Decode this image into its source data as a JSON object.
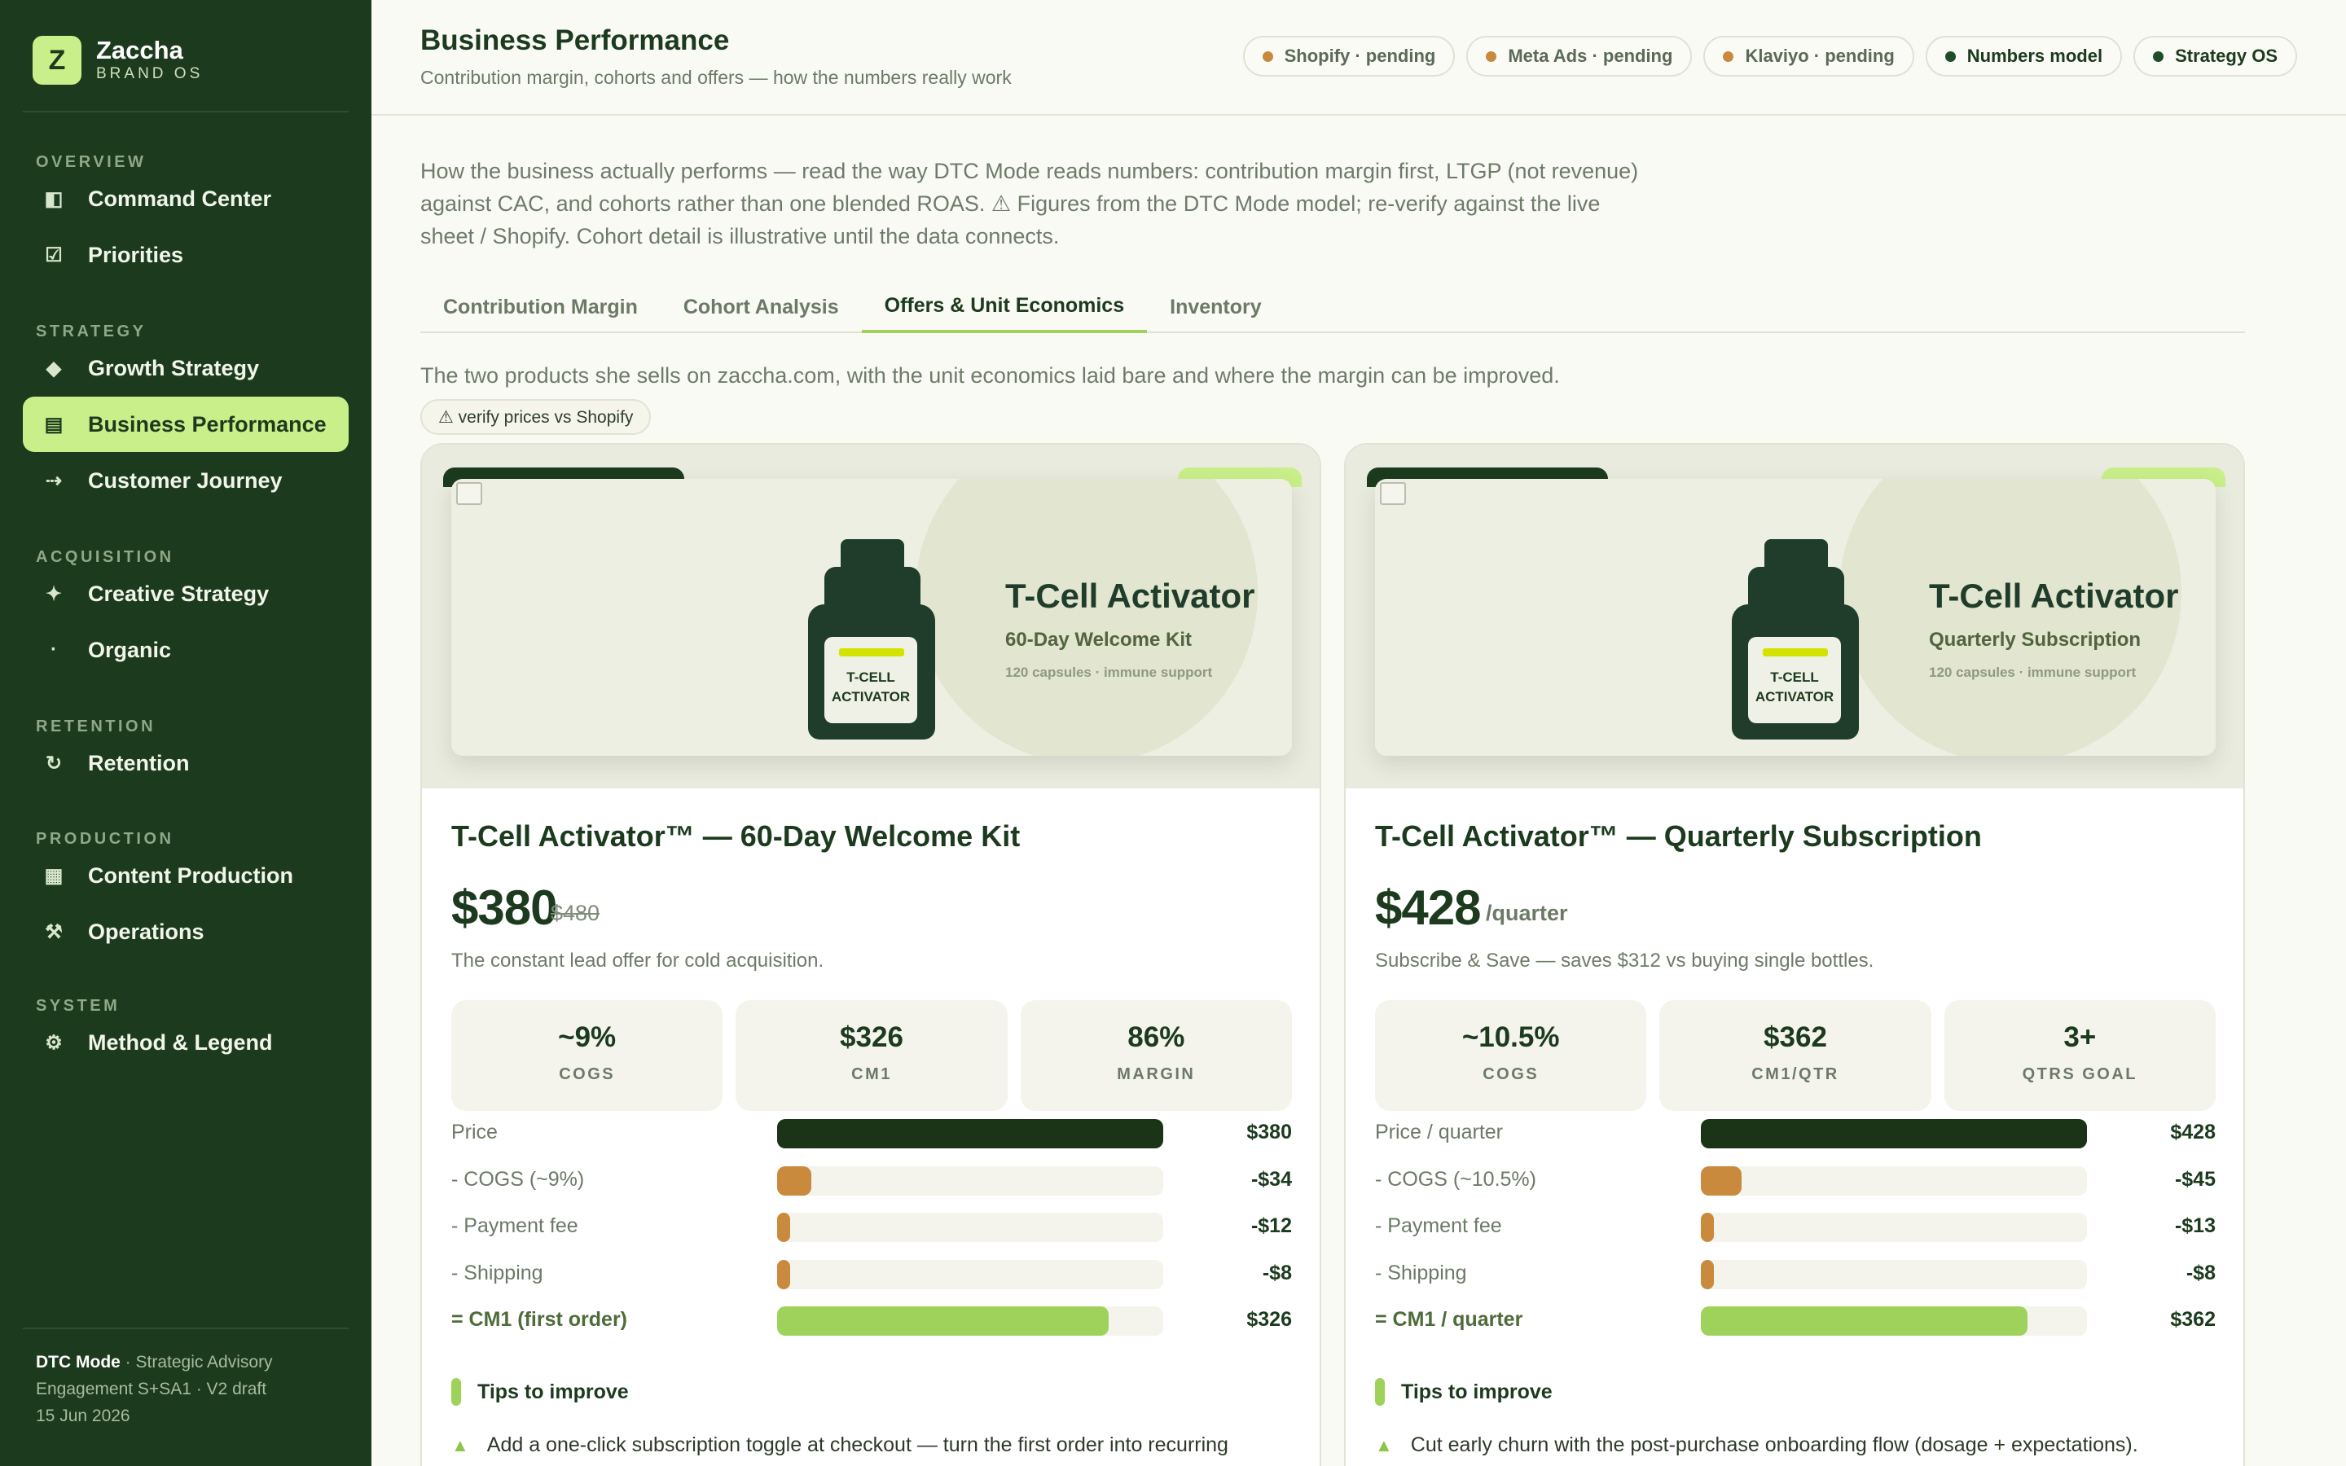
{
  "brand": {
    "logo_letter": "Z",
    "name": "Zaccha",
    "sub": "BRAND OS"
  },
  "sidebar": {
    "sections": [
      {
        "title": "OVERVIEW",
        "items": [
          {
            "label": "Command Center",
            "icon": "panel-icon",
            "glyph": "◧"
          },
          {
            "label": "Priorities",
            "icon": "checkbox-icon",
            "glyph": "☑"
          }
        ]
      },
      {
        "title": "STRATEGY",
        "items": [
          {
            "label": "Growth Strategy",
            "icon": "diamond-icon",
            "glyph": "◆"
          },
          {
            "label": "Business Performance",
            "icon": "report-icon",
            "glyph": "▤",
            "active": true
          },
          {
            "label": "Customer Journey",
            "icon": "journey-arrow-icon",
            "glyph": "⇢"
          }
        ]
      },
      {
        "title": "ACQUISITION",
        "items": [
          {
            "label": "Creative Strategy",
            "icon": "sparkle-icon",
            "glyph": "✦"
          },
          {
            "label": "Organic",
            "icon": "dot-icon",
            "glyph": "·"
          }
        ]
      },
      {
        "title": "RETENTION",
        "items": [
          {
            "label": "Retention",
            "icon": "refresh-icon",
            "glyph": "↻"
          }
        ]
      },
      {
        "title": "PRODUCTION",
        "items": [
          {
            "label": "Content Production",
            "icon": "grid-icon",
            "glyph": "▦"
          },
          {
            "label": "Operations",
            "icon": "tools-icon",
            "glyph": "⚒"
          }
        ]
      },
      {
        "title": "SYSTEM",
        "items": [
          {
            "label": "Method & Legend",
            "icon": "gear-icon",
            "glyph": "⚙"
          }
        ]
      }
    ],
    "footer": {
      "brand": "DTC Mode",
      "line1": " · Strategic Advisory",
      "line2": "Engagement S+SA1 · V2 draft",
      "line3": "15 Jun 2026"
    }
  },
  "header": {
    "title": "Business Performance",
    "subtitle": "Contribution margin, cohorts and offers — how the numbers really work",
    "pills": [
      {
        "label": "Shopify · pending",
        "color": "#c98a3e"
      },
      {
        "label": "Meta Ads · pending",
        "color": "#c98a3e"
      },
      {
        "label": "Klaviyo · pending",
        "color": "#c98a3e"
      },
      {
        "label": "Numbers model",
        "color": "#1f4d2a"
      },
      {
        "label": "Strategy OS",
        "color": "#1f4d2a"
      }
    ]
  },
  "intro": "How the business actually performs — read the way DTC Mode reads numbers: contribution margin first, LTGP (not revenue) against CAC, and cohorts rather than one blended ROAS. ⚠ Figures from the DTC Mode model; re-verify against the live sheet / Shopify. Cohort detail is illustrative until the data connects.",
  "tabs": [
    {
      "label": "Contribution Margin"
    },
    {
      "label": "Cohort Analysis"
    },
    {
      "label": "Offers & Unit Economics",
      "active": true
    },
    {
      "label": "Inventory"
    }
  ],
  "offers": {
    "description": "The two products she sells on zaccha.com, with the unit economics laid bare and where the margin can be improved.",
    "verify_badge": "⚠ verify prices vs Shopify",
    "tips_title": "Tips to improve",
    "cards": [
      {
        "hero": {
          "product": "T-Cell Activator",
          "variant": "60-Day Welcome Kit",
          "caps": "120 capsules · immune support",
          "bottle_label": "T-CELL ACTIVATOR"
        },
        "title": "T-Cell Activator™ — 60-Day Welcome Kit",
        "price": "$380",
        "was_price": "$480",
        "unit": "",
        "note": "The constant lead offer for cold acquisition.",
        "stats": [
          {
            "value": "~9%",
            "label": "COGS"
          },
          {
            "value": "$326",
            "label": "CM1"
          },
          {
            "value": "86%",
            "label": "MARGIN"
          }
        ],
        "waterfall": [
          {
            "label": "Price",
            "value": "$380",
            "fraction": 1.0,
            "kind": "price"
          },
          {
            "label": "- COGS (~9%)",
            "value": "-$34",
            "fraction": 0.089,
            "kind": "cost"
          },
          {
            "label": "- Payment fee",
            "value": "-$12",
            "fraction": 0.032,
            "kind": "cost"
          },
          {
            "label": "- Shipping",
            "value": "-$8",
            "fraction": 0.021,
            "kind": "cost"
          },
          {
            "label": "= CM1 (first order)",
            "value": "$326",
            "fraction": 0.858,
            "kind": "result"
          }
        ],
        "tip": "Add a one-click subscription toggle at checkout — turn the first order into recurring"
      },
      {
        "hero": {
          "product": "T-Cell Activator",
          "variant": "Quarterly Subscription",
          "caps": "120 capsules · immune support",
          "bottle_label": "T-CELL ACTIVATOR"
        },
        "title": "T-Cell Activator™ — Quarterly Subscription",
        "price": "$428",
        "was_price": "",
        "unit": "/quarter",
        "note": "Subscribe & Save — saves $312 vs buying single bottles.",
        "stats": [
          {
            "value": "~10.5%",
            "label": "COGS"
          },
          {
            "value": "$362",
            "label": "CM1/QTR"
          },
          {
            "value": "3+",
            "label": "QTRS GOAL"
          }
        ],
        "waterfall": [
          {
            "label": "Price / quarter",
            "value": "$428",
            "fraction": 1.0,
            "kind": "price"
          },
          {
            "label": "- COGS (~10.5%)",
            "value": "-$45",
            "fraction": 0.105,
            "kind": "cost"
          },
          {
            "label": "- Payment fee",
            "value": "-$13",
            "fraction": 0.03,
            "kind": "cost"
          },
          {
            "label": "- Shipping",
            "value": "-$8",
            "fraction": 0.019,
            "kind": "cost"
          },
          {
            "label": "= CM1 / quarter",
            "value": "$362",
            "fraction": 0.846,
            "kind": "result"
          }
        ],
        "tip": "Cut early churn with the post-purchase onboarding flow (dosage + expectations)."
      }
    ]
  },
  "colors": {
    "sidebar_bg": "#1c3a1e",
    "accent": "#c9ef8a",
    "price_bar": "#1b3317",
    "cost_bar": "#c98a3e",
    "cm1_bar": "#9ed25a"
  }
}
